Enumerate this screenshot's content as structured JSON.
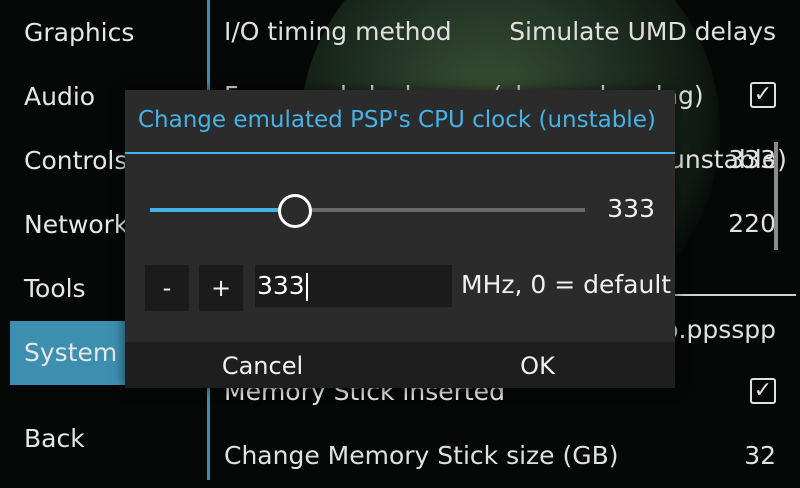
{
  "sidebar": {
    "items": [
      {
        "label": "Graphics"
      },
      {
        "label": "Audio"
      },
      {
        "label": "Controls"
      },
      {
        "label": "Networking"
      },
      {
        "label": "Tools"
      },
      {
        "label": "System",
        "selected": true
      },
      {
        "label": "Back"
      }
    ]
  },
  "settings": {
    "io_timing": {
      "label": "I/O timing method",
      "value": "Simulate UMD delays"
    },
    "force_realclock": {
      "label": "Force real clock sync (slower, less lag)",
      "checked": true
    },
    "cpu_clock": {
      "label": "Change emulated PSP's CPU clock (unstable)",
      "value": "333"
    },
    "row_220": {
      "value": "220"
    },
    "memstick_path": {
      "label": "ppsspp.ppsspp"
    },
    "memstick_inserted": {
      "label": "Memory Stick inserted",
      "checked": true
    },
    "memstick_size": {
      "label": "Change Memory Stick size (GB)",
      "value": "32"
    }
  },
  "dialog": {
    "title": "Change emulated PSP's CPU clock (unstable)",
    "slider": {
      "value": 333,
      "fill_fraction": 0.33
    },
    "slider_value_text": "333",
    "minus_label": "-",
    "plus_label": "+",
    "input_value": "333",
    "units_label": "MHz, 0 = default",
    "cancel_label": "Cancel",
    "ok_label": "OK"
  },
  "colors": {
    "accent": "#45b3e7",
    "selected_bg": "#3d8fb0",
    "dialog_bg": "#2b2b2b"
  },
  "icons": {
    "checkbox": "checked-checkbox-icon"
  }
}
